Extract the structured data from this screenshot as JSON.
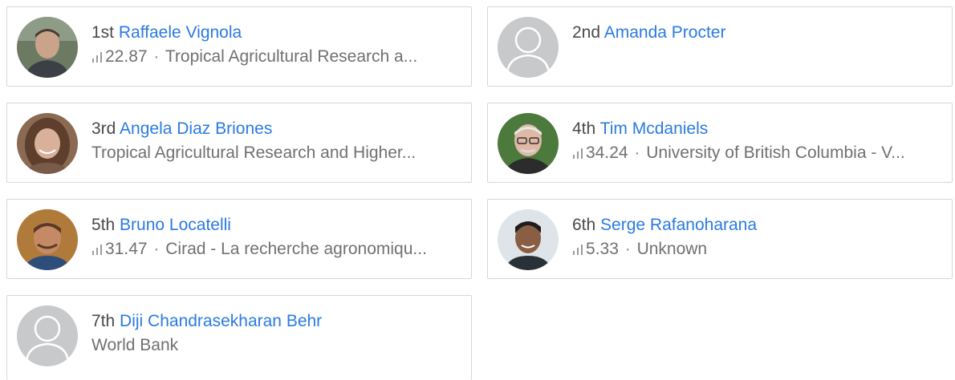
{
  "people": [
    {
      "rank": "1st",
      "name": "Raffaele Vignola",
      "score": "22.87",
      "affiliation": "Tropical Agricultural Research a...",
      "avatar": "photo-avatar-icon"
    },
    {
      "rank": "2nd",
      "name": "Amanda Procter",
      "avatar": "default-avatar-icon"
    },
    {
      "rank": "3rd",
      "name": "Angela Diaz Briones",
      "affiliation": "Tropical Agricultural Research and Higher...",
      "avatar": "photo-avatar-icon"
    },
    {
      "rank": "4th",
      "name": "Tim Mcdaniels",
      "score": "34.24",
      "affiliation": "University of British Columbia - V...",
      "avatar": "photo-avatar-icon"
    },
    {
      "rank": "5th",
      "name": "Bruno Locatelli",
      "score": "31.47",
      "affiliation": "Cirad - La recherche agronomiqu...",
      "avatar": "photo-avatar-icon"
    },
    {
      "rank": "6th",
      "name": "Serge Rafanoharana",
      "score": "5.33",
      "affiliation": "Unknown",
      "avatar": "photo-avatar-icon"
    },
    {
      "rank": "7th",
      "name": "Diji Chandrasekharan Behr",
      "affiliation": "World Bank",
      "avatar": "default-avatar-icon"
    }
  ],
  "separator": "·",
  "colors": {
    "link": "#2a7ae2",
    "text": "#4a4a4a",
    "meta": "#707070",
    "border": "#d6d6d6",
    "default_avatar_bg": "#c8c9cb"
  }
}
